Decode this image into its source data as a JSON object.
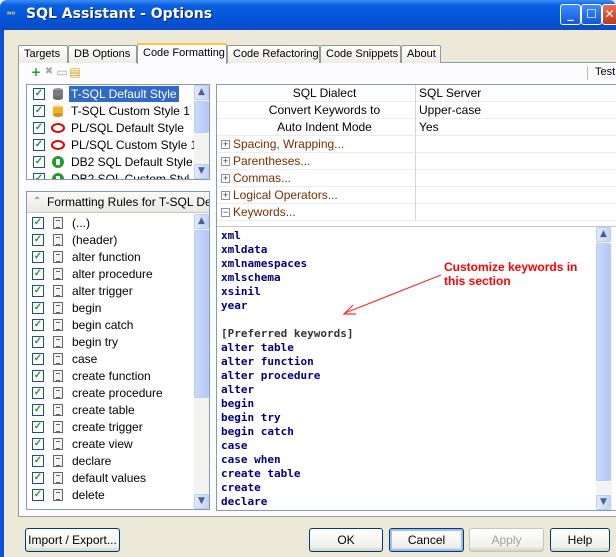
{
  "window": {
    "title": "SQL Assistant - Options",
    "icon_text": "ᴺᴽ",
    "minimize": "_",
    "maximize": "☐",
    "close": "✕"
  },
  "tabs": [
    {
      "label": "Targets"
    },
    {
      "label": "DB Options"
    },
    {
      "label": "Code Formatting"
    },
    {
      "label": "Code Refactoring"
    },
    {
      "label": "Code Snippets"
    },
    {
      "label": "About"
    }
  ],
  "toolbar": {
    "add_icon": "+",
    "delete_icon": "✖",
    "copy_icon": "▭",
    "paste_icon": "▤",
    "test_label": "Test..."
  },
  "styles": [
    {
      "label": "T-SQL Default Style",
      "checked": "✓",
      "selected": true,
      "icon_color": "#7a7a7a"
    },
    {
      "label": "T-SQL Custom Style 1",
      "checked": "✓",
      "icon_color": "#f3b12a"
    },
    {
      "label": "PL/SQL Default Style",
      "checked": "✓",
      "icon_color": "#e00000"
    },
    {
      "label": "PL/SQL Custom Style 1",
      "checked": "✓",
      "icon_color": "#e00000"
    },
    {
      "label": "DB2 SQL Default Style",
      "checked": "✓",
      "icon_color": "#1f9d2b"
    },
    {
      "label": "DB2 SQL Custom Styl",
      "checked": "✓",
      "icon_color": "#1f9d2b"
    }
  ],
  "rules": {
    "header": "Formatting Rules for T-SQL Def...",
    "items": [
      {
        "label": "(...)"
      },
      {
        "label": "(header)"
      },
      {
        "label": "alter function"
      },
      {
        "label": "alter procedure"
      },
      {
        "label": "alter trigger"
      },
      {
        "label": "begin"
      },
      {
        "label": "begin catch"
      },
      {
        "label": "begin try"
      },
      {
        "label": "case"
      },
      {
        "label": "create function"
      },
      {
        "label": "create procedure"
      },
      {
        "label": "create table"
      },
      {
        "label": "create trigger"
      },
      {
        "label": "create view"
      },
      {
        "label": "declare"
      },
      {
        "label": "default values"
      },
      {
        "label": "delete"
      }
    ],
    "check": "✓"
  },
  "properties": [
    {
      "name": "SQL Dialect",
      "value": "SQL Server"
    },
    {
      "name": "Convert Keywords to",
      "value": "Upper-case"
    },
    {
      "name": "Auto Indent Mode",
      "value": "Yes"
    }
  ],
  "groups": [
    {
      "name": "Spacing, Wrapping...",
      "expander": "+"
    },
    {
      "name": "Parentheses...",
      "expander": "+"
    },
    {
      "name": "Commas...",
      "expander": "+"
    },
    {
      "name": "Logical Operators...",
      "expander": "+"
    },
    {
      "name": "Keywords...",
      "expander": "−"
    }
  ],
  "keywords": [
    "xml",
    "xmldata",
    "xmlnamespaces",
    "xmlschema",
    "xsinil",
    "year",
    "",
    "[Preferred keywords]",
    "alter table",
    "alter function",
    "alter procedure",
    "alter",
    "begin",
    "begin try",
    "begin catch",
    "case",
    "case when",
    "create table",
    "create",
    "declare"
  ],
  "annotation": "Customize keywords in this section",
  "buttons": {
    "import_export": "Import / Export...",
    "ok": "OK",
    "cancel": "Cancel",
    "apply": "Apply",
    "help": "Help"
  },
  "scroll": {
    "up": "▲",
    "down": "▼"
  }
}
